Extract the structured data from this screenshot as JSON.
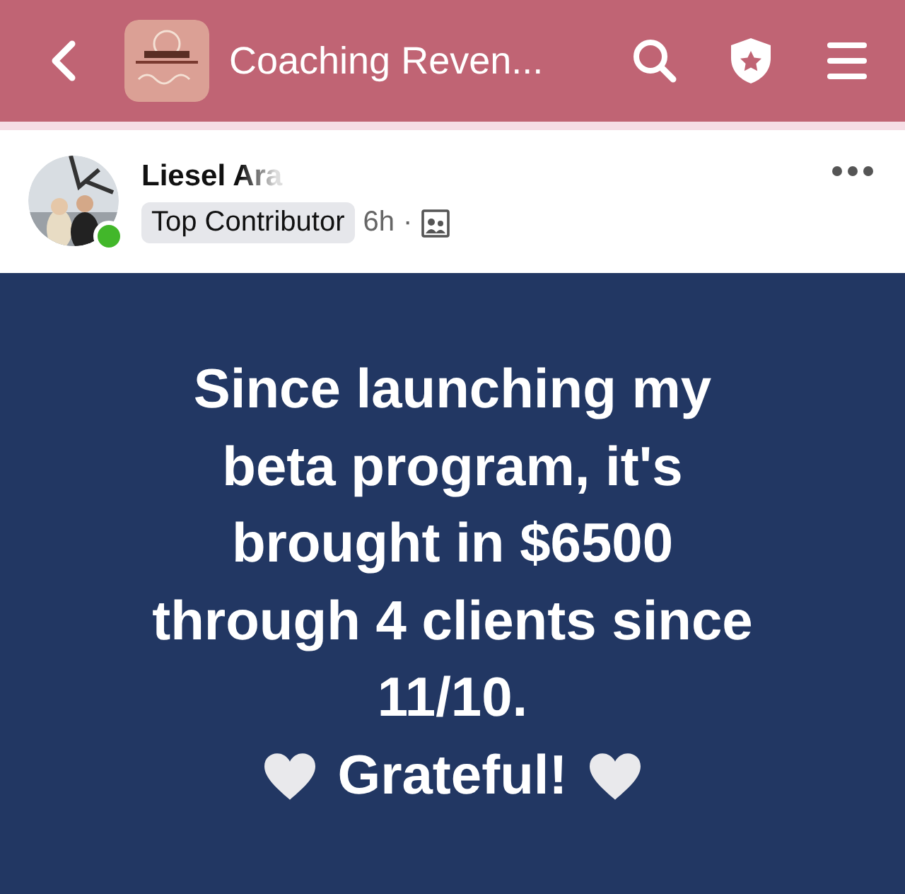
{
  "header": {
    "title": "Coaching Reven..."
  },
  "post": {
    "author": "Liesel Ara",
    "online": true,
    "badge": "Top Contributor",
    "time": "6h",
    "separator": "·",
    "lines": [
      "Since launching my",
      "beta program, it's",
      "brought in $6500",
      "through 4 clients since",
      "11/10."
    ],
    "closing": "Grateful!"
  }
}
